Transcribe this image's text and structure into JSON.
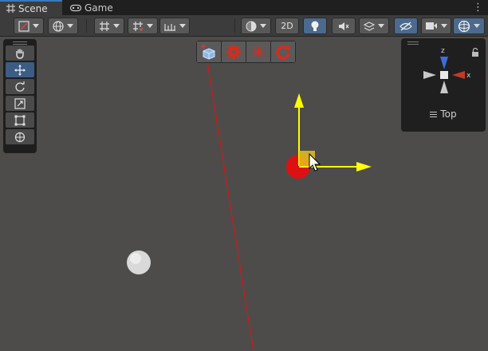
{
  "tabs": [
    {
      "label": "Scene",
      "icon": "grid-icon",
      "active": true
    },
    {
      "label": "Game",
      "icon": "gamepad-icon",
      "active": false
    }
  ],
  "toolbar": {
    "mode_2d_label": "2D"
  },
  "gizmo": {
    "view_label": "Top",
    "axis_z": "z",
    "axis_x": "x"
  },
  "colors": {
    "accent": "#3a79bb",
    "axis_x": "#c23a2a",
    "axis_z": "#3a6ee0",
    "handle_yellow": "#ffff00",
    "sphere_red": "#dd1111",
    "sphere_white": "#d9d9d9",
    "line_red": "#cc1a1a",
    "viewport_bg": "#4e4c4a"
  }
}
